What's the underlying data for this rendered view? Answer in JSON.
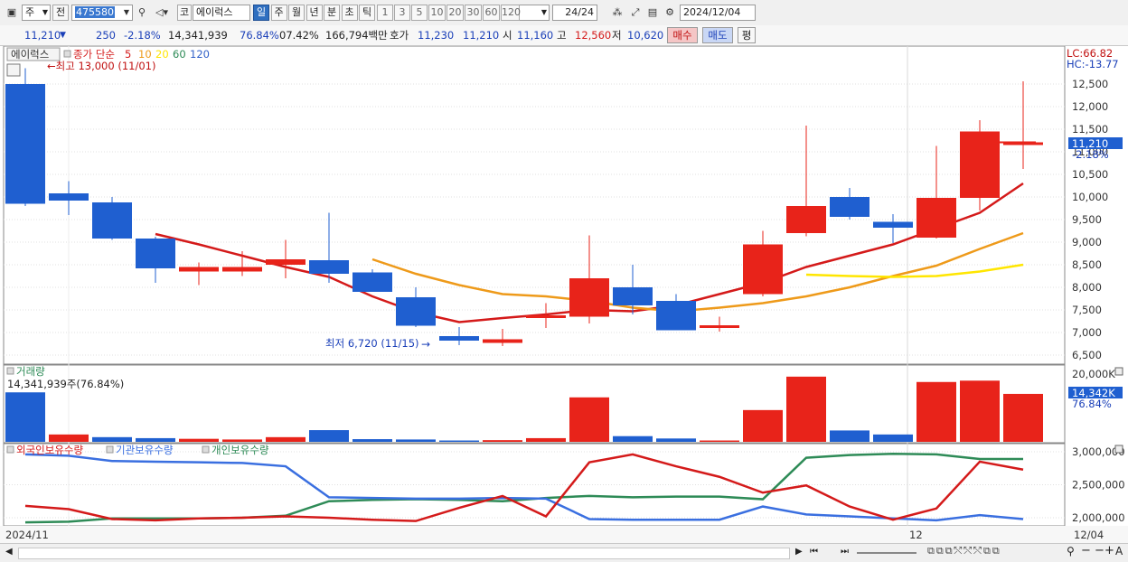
{
  "toolbar": {
    "type_select": "주",
    "prev_label": "전",
    "code": "475580",
    "market_label": "코",
    "stock_name": "에이럭스",
    "periods": [
      "일",
      "주",
      "월",
      "년",
      "분",
      "초",
      "틱"
    ],
    "selected_period": "일",
    "intervals": [
      "1",
      "3",
      "5",
      "10",
      "20",
      "30",
      "60",
      "120"
    ],
    "page_count": "24/24",
    "date": "2024/12/04"
  },
  "quote": {
    "price": "11,210",
    "change": "250",
    "change_pct": "-2.18%",
    "volume": "14,341,939",
    "vol_ratio": "76.84%",
    "turnover": "07.42%",
    "amount": "166,794백만",
    "ask_label": "호가",
    "ask": "11,230",
    "bid": "11,210",
    "open_label": "시",
    "open": "11,160",
    "high_label": "고",
    "high": "12,560",
    "low_label": "저",
    "low": "10,620",
    "buy_label": "매수",
    "sell_label": "매도",
    "eval_label": "평"
  },
  "price_panel": {
    "name": "에이럭스",
    "ma_label": "종가 단순",
    "ma_periods": [
      "5",
      "10",
      "20",
      "60",
      "120"
    ],
    "ma_colors": [
      "#d41a1a",
      "#ee9a1a",
      "#ffe600",
      "#2e8b57",
      "#3060c8"
    ],
    "high_note": "최고 13,000 (11/01)",
    "low_note": "최저 6,720 (11/15)",
    "lc": "LC:66.82",
    "hc": "HC:-13.77",
    "current_price": "11,210",
    "current_change": "-2.18%",
    "y_ticks": [
      "12,500",
      "12,000",
      "11,500",
      "11,000",
      "10,500",
      "10,000",
      "9,500",
      "9,000",
      "8,500",
      "8,000",
      "7,500",
      "7,000",
      "6,500"
    ]
  },
  "volume_panel": {
    "title": "거래량",
    "value": "14,341,939주(76.84%)",
    "y_max": "20,000K",
    "current": "14,342K",
    "current_pct": "76.84%"
  },
  "holdings_panel": {
    "legend": [
      "외국인보유수량",
      "기관보유수량",
      "개인보유수량"
    ],
    "colors": [
      "#d41a1a",
      "#3a6fe0",
      "#2e8b57"
    ],
    "y_ticks": [
      "3,000,000",
      "2,500,000",
      "2,000,000"
    ]
  },
  "x_axis": {
    "left_label": "2024/11",
    "month_label": "12",
    "right_label": "12/04"
  },
  "chart_data": {
    "type": "candlestick",
    "price_range": [
      6300,
      13200
    ],
    "candles": [
      {
        "o": 12500,
        "h": 12850,
        "l": 9800,
        "c": 9850
      },
      {
        "o": 10080,
        "h": 10350,
        "l": 9600,
        "c": 9920
      },
      {
        "o": 9880,
        "h": 10000,
        "l": 9050,
        "c": 9080
      },
      {
        "o": 9080,
        "h": 9120,
        "l": 8100,
        "c": 8420
      },
      {
        "o": 8350,
        "h": 8550,
        "l": 8050,
        "c": 8450
      },
      {
        "o": 8350,
        "h": 8800,
        "l": 8250,
        "c": 8450
      },
      {
        "o": 8500,
        "h": 9050,
        "l": 8200,
        "c": 8620
      },
      {
        "o": 8600,
        "h": 9650,
        "l": 8100,
        "c": 8300
      },
      {
        "o": 8330,
        "h": 8400,
        "l": 7900,
        "c": 7900
      },
      {
        "o": 7780,
        "h": 8000,
        "l": 7120,
        "c": 7150
      },
      {
        "o": 6920,
        "h": 7120,
        "l": 6720,
        "c": 6820
      },
      {
        "o": 6770,
        "h": 7080,
        "l": 6700,
        "c": 6850
      },
      {
        "o": 7350,
        "h": 7650,
        "l": 7100,
        "c": 7380
      },
      {
        "o": 7350,
        "h": 9150,
        "l": 7200,
        "c": 8200
      },
      {
        "o": 8000,
        "h": 8500,
        "l": 7400,
        "c": 7600
      },
      {
        "o": 7700,
        "h": 7850,
        "l": 7050,
        "c": 7050
      },
      {
        "o": 7150,
        "h": 7350,
        "l": 7020,
        "c": 7160
      },
      {
        "o": 7850,
        "h": 9250,
        "l": 7800,
        "c": 8950
      },
      {
        "o": 9200,
        "h": 11580,
        "l": 9130,
        "c": 9800
      },
      {
        "o": 10000,
        "h": 10200,
        "l": 9500,
        "c": 9560
      },
      {
        "o": 9450,
        "h": 9620,
        "l": 8980,
        "c": 9320
      },
      {
        "o": 9100,
        "h": 11130,
        "l": 9080,
        "c": 9980
      },
      {
        "o": 9980,
        "h": 11700,
        "l": 9700,
        "c": 11450
      },
      {
        "o": 11160,
        "h": 12560,
        "l": 10620,
        "c": 11210
      }
    ],
    "ma5": [
      [
        4,
        9180
      ],
      [
        5,
        8950
      ],
      [
        6,
        8700
      ],
      [
        7,
        8450
      ],
      [
        8,
        8230
      ],
      [
        9,
        7800
      ],
      [
        10,
        7450
      ],
      [
        11,
        7230
      ],
      [
        12,
        7320
      ],
      [
        13,
        7400
      ],
      [
        14,
        7500
      ],
      [
        15,
        7470
      ],
      [
        16,
        7600
      ],
      [
        17,
        7850
      ],
      [
        18,
        8100
      ],
      [
        19,
        8450
      ],
      [
        20,
        8700
      ],
      [
        21,
        8950
      ],
      [
        22,
        9300
      ],
      [
        23,
        9650
      ],
      [
        24,
        10300
      ]
    ],
    "ma10": [
      [
        9,
        8620
      ],
      [
        10,
        8300
      ],
      [
        11,
        8050
      ],
      [
        12,
        7850
      ],
      [
        13,
        7800
      ],
      [
        14,
        7700
      ],
      [
        15,
        7550
      ],
      [
        16,
        7470
      ],
      [
        17,
        7550
      ],
      [
        18,
        7650
      ],
      [
        19,
        7800
      ],
      [
        20,
        8000
      ],
      [
        21,
        8250
      ],
      [
        22,
        8480
      ],
      [
        23,
        8850
      ],
      [
        24,
        9200
      ]
    ],
    "ma20": [
      [
        19,
        8280
      ],
      [
        20,
        8250
      ],
      [
        21,
        8230
      ],
      [
        22,
        8250
      ],
      [
        23,
        8350
      ],
      [
        24,
        8500
      ]
    ],
    "volume_max": 20000,
    "volume": [
      14800,
      2200,
      1400,
      1100,
      900,
      700,
      1400,
      3500,
      800,
      700,
      400,
      500,
      1100,
      13300,
      1700,
      1000,
      400,
      9500,
      19500,
      3400,
      2200,
      17900,
      18300,
      14342
    ],
    "volume_dir": [
      "down",
      "up",
      "down",
      "down",
      "up",
      "up",
      "up",
      "down",
      "down",
      "down",
      "down",
      "up",
      "up",
      "up",
      "down",
      "down",
      "up",
      "up",
      "up",
      "down",
      "down",
      "up",
      "up",
      "up"
    ],
    "holdings_range": [
      1900000,
      3100000
    ],
    "foreign": [
      2180000,
      2130000,
      1980000,
      1960000,
      1990000,
      2000000,
      2020000,
      2000000,
      1970000,
      1950000,
      2150000,
      2330000,
      2020000,
      2840000,
      2960000,
      2780000,
      2620000,
      2380000,
      2490000,
      2170000,
      1970000,
      2140000,
      2850000,
      2730000
    ],
    "institution": [
      2960000,
      2940000,
      2860000,
      2850000,
      2840000,
      2830000,
      2780000,
      2310000,
      2300000,
      2290000,
      2290000,
      2300000,
      2290000,
      1980000,
      1970000,
      1970000,
      1970000,
      2170000,
      2050000,
      2020000,
      1990000,
      1960000,
      2040000,
      1980000
    ],
    "individual": [
      1930000,
      1940000,
      1990000,
      1990000,
      1990000,
      2000000,
      2030000,
      2250000,
      2270000,
      2280000,
      2270000,
      2250000,
      2300000,
      2330000,
      2310000,
      2320000,
      2320000,
      2280000,
      2910000,
      2950000,
      2970000,
      2960000,
      2890000,
      2890000
    ]
  }
}
